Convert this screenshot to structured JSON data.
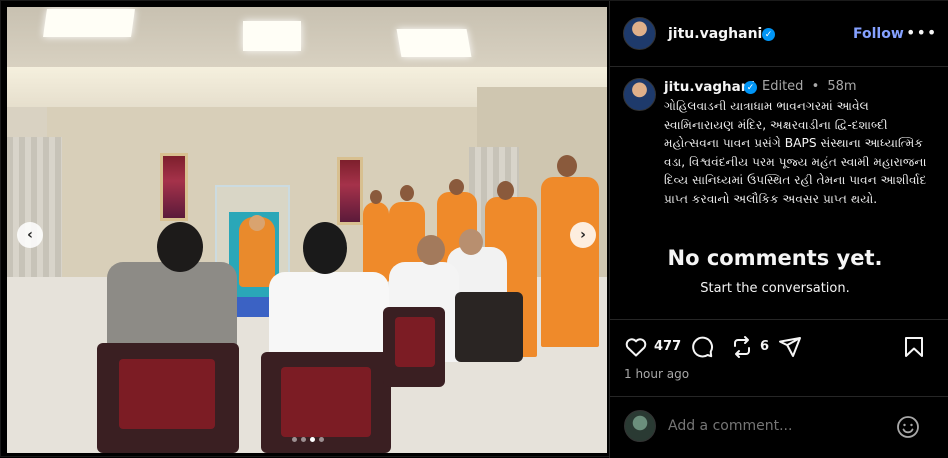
{
  "post": {
    "carousel": {
      "total_slides": 4,
      "active_slide": 3
    },
    "author": {
      "username": "jitu.vaghani",
      "verified": true
    },
    "follow_label": "Follow",
    "more_label": "•••",
    "edited_label": "Edited",
    "separator": "•",
    "time_ago": "58m",
    "caption": "ગોહિલવાડની યાત્રાધામ ભાવનગરમાં આવેલ સ્વામિનારાયણ મંદિર, અક્ષરવાડીના દ્વિ-દશાબ્દી મહોત્સવના પાવન પ્રસંગે BAPS સંસ્થાના આધ્યાત્મિક વડા, વિશ્વવંદનીય પરમ પૂજ્ય મહંત સ્વામી મહારાજના દિવ્ય સાનિધ્યમાં ઉપસ્થિત રહી તેમના પાવન આશીર્વાદ પ્રાપ્ત કરવાનો અલૌકિક અવસર પ્રાપ્ત થયો.",
    "no_comments_title": "No comments yet.",
    "no_comments_sub": "Start the conversation.",
    "likes": "477",
    "reposts": "6",
    "posted": "1 hour ago",
    "comment_placeholder": "Add a comment...",
    "icons": [
      "heart-icon",
      "comment-icon",
      "repost-icon",
      "share-icon",
      "bookmark-icon",
      "emoji-icon",
      "chevron-left-icon",
      "chevron-right-icon",
      "verified-icon"
    ]
  },
  "colors": {
    "background": "#000000",
    "follow": "#85a1ff",
    "verified": "#0095f6",
    "muted": "#a8a8a8"
  }
}
